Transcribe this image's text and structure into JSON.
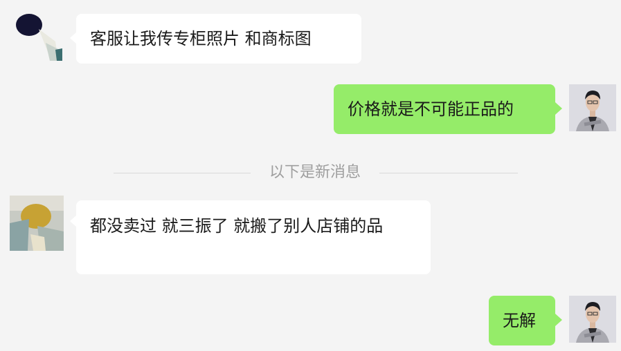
{
  "messages": [
    {
      "side": "in",
      "text": "客服让我传专柜照片 和商标图",
      "avatar": "contact-avatar-1"
    },
    {
      "side": "out",
      "text": "价格就是不可能正品的",
      "avatar": "self-avatar"
    },
    {
      "side": "in",
      "text": "都没卖过  就三振了 就搬了别人店铺的品",
      "avatar": "contact-avatar-2"
    },
    {
      "side": "out",
      "text": "无解",
      "avatar": "self-avatar"
    }
  ],
  "divider": {
    "label": "以下是新消息"
  },
  "colors": {
    "background": "#f4f4f4",
    "incoming_bubble": "#ffffff",
    "outgoing_bubble": "#95ec69",
    "divider_text": "#9e9e9e"
  }
}
